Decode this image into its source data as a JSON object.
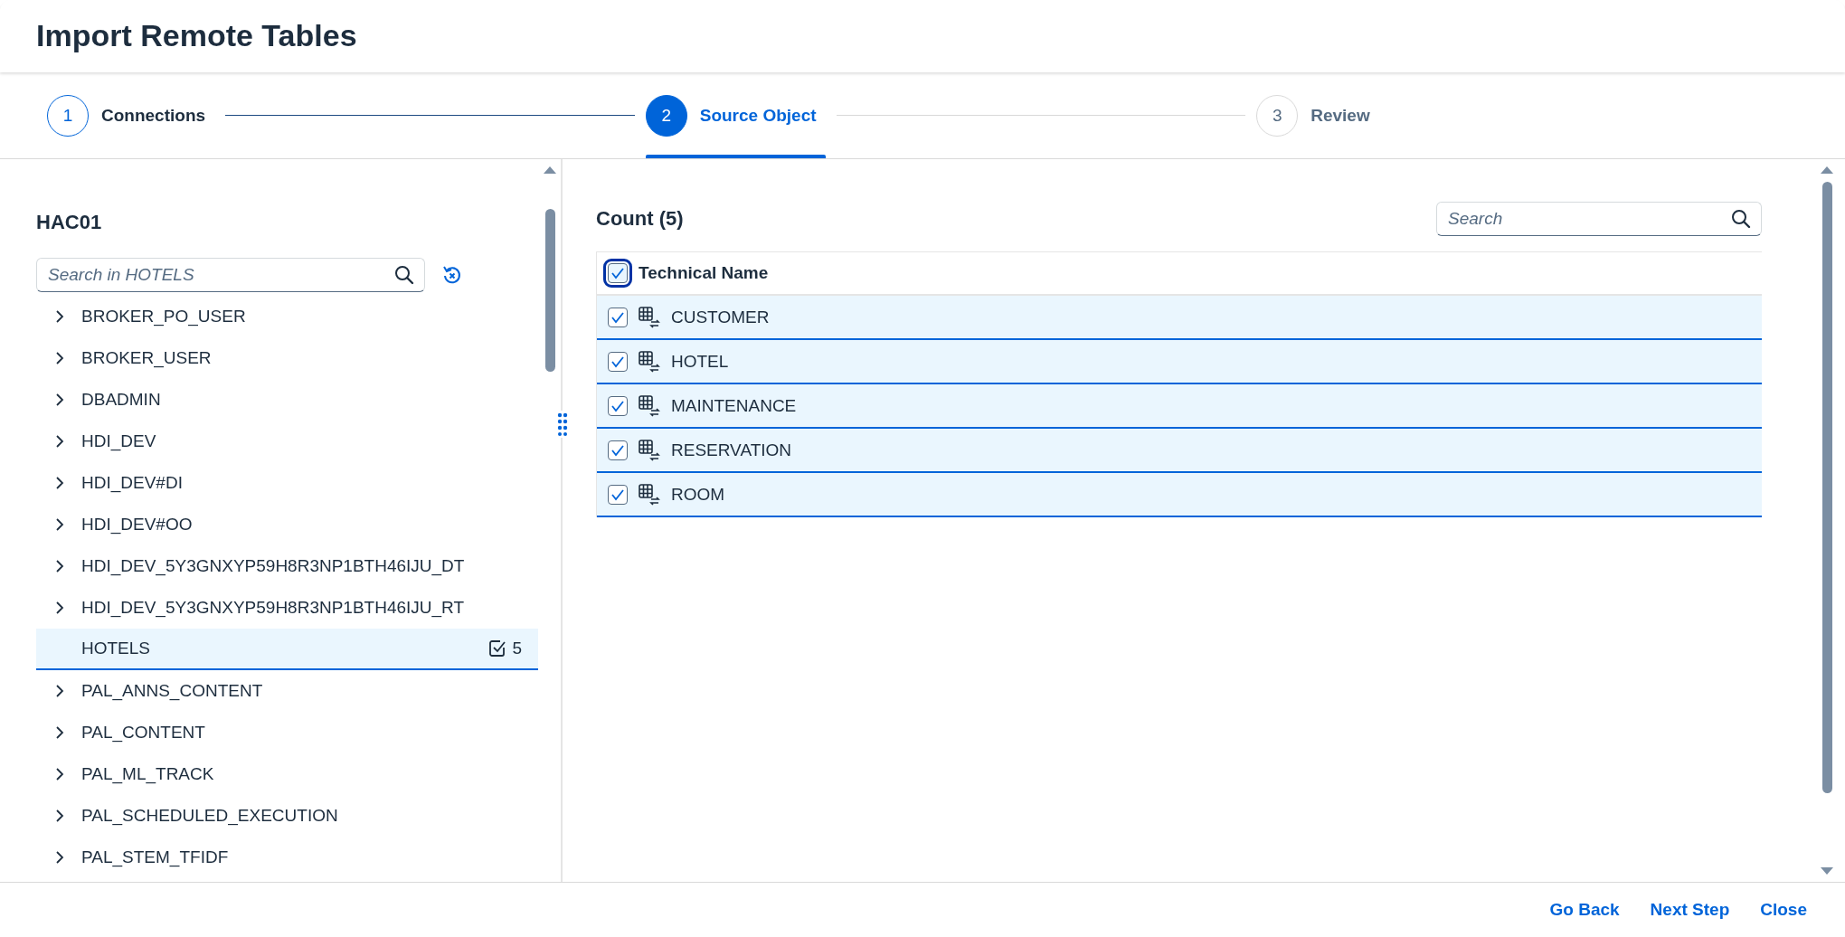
{
  "dialog": {
    "title": "Import Remote Tables"
  },
  "steps": [
    {
      "number": "1",
      "label": "Connections",
      "completed": true,
      "selected": false
    },
    {
      "number": "2",
      "label": "Source Object",
      "completed": false,
      "selected": true
    },
    {
      "number": "3",
      "label": "Review",
      "completed": false,
      "selected": false
    }
  ],
  "tree": {
    "title": "HAC01",
    "search": {
      "placeholder": "Search in HOTELS"
    },
    "items": [
      {
        "label": "BROKER_PO_USER",
        "expandable": true,
        "selected": false
      },
      {
        "label": "BROKER_USER",
        "expandable": true,
        "selected": false
      },
      {
        "label": "DBADMIN",
        "expandable": true,
        "selected": false
      },
      {
        "label": "HDI_DEV",
        "expandable": true,
        "selected": false
      },
      {
        "label": "HDI_DEV#DI",
        "expandable": true,
        "selected": false
      },
      {
        "label": "HDI_DEV#OO",
        "expandable": true,
        "selected": false
      },
      {
        "label": "HDI_DEV_5Y3GNXYP59H8R3NP1BTH46IJU_DT",
        "expandable": true,
        "selected": false
      },
      {
        "label": "HDI_DEV_5Y3GNXYP59H8R3NP1BTH46IJU_RT",
        "expandable": true,
        "selected": false
      },
      {
        "label": "HOTELS",
        "expandable": false,
        "selected": true,
        "selected_count": "5"
      },
      {
        "label": "PAL_ANNS_CONTENT",
        "expandable": true,
        "selected": false
      },
      {
        "label": "PAL_CONTENT",
        "expandable": true,
        "selected": false
      },
      {
        "label": "PAL_ML_TRACK",
        "expandable": true,
        "selected": false
      },
      {
        "label": "PAL_SCHEDULED_EXECUTION",
        "expandable": true,
        "selected": false
      },
      {
        "label": "PAL_STEM_TFIDF",
        "expandable": true,
        "selected": false
      }
    ]
  },
  "table": {
    "title": "Count (5)",
    "search": {
      "placeholder": "Search"
    },
    "select_all": {
      "checked": true
    },
    "columns": [
      "Technical Name"
    ],
    "rows": [
      {
        "name": "CUSTOMER",
        "checked": true,
        "selected": true
      },
      {
        "name": "HOTEL",
        "checked": true,
        "selected": true
      },
      {
        "name": "MAINTENANCE",
        "checked": true,
        "selected": true
      },
      {
        "name": "RESERVATION",
        "checked": true,
        "selected": true
      },
      {
        "name": "ROOM",
        "checked": true,
        "selected": true
      }
    ]
  },
  "footer": {
    "buttons": [
      "Go Back",
      "Next Step",
      "Close"
    ]
  }
}
